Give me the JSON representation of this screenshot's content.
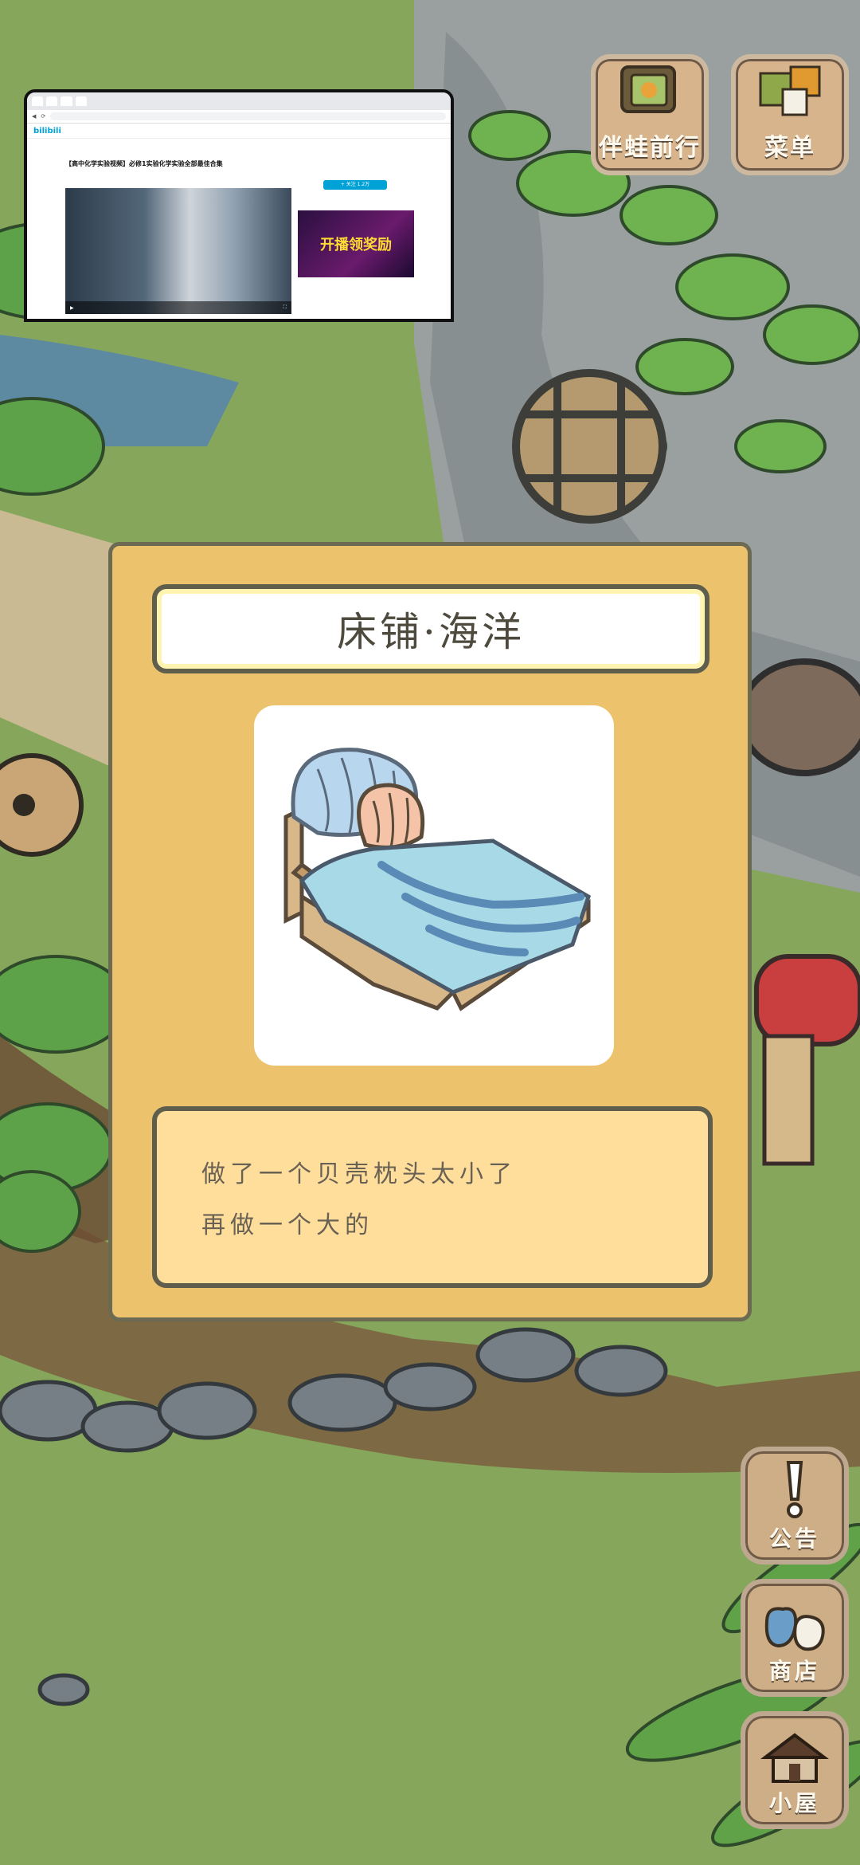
{
  "top_buttons": {
    "travel_label": "伴蛙前行",
    "menu_label": "菜单"
  },
  "side_buttons": {
    "notice_label": "公告",
    "shop_label": "商店",
    "house_label": "小屋"
  },
  "item_card": {
    "title": "床铺·海洋",
    "description_lines": [
      "做了一个贝壳枕头太小了",
      "再做一个大的"
    ]
  },
  "browser_overlay": {
    "logo": "bilibili",
    "video_title": "【高中化学实验视频】必修1实验化学实验全部最佳合集",
    "ad_text": "开播领奖励",
    "follow_label": "+ 关注 1.2万"
  },
  "colors": {
    "card_bg": "#ecc36c",
    "desc_bg": "#fede9a",
    "button_bg": "#d7b48c"
  }
}
